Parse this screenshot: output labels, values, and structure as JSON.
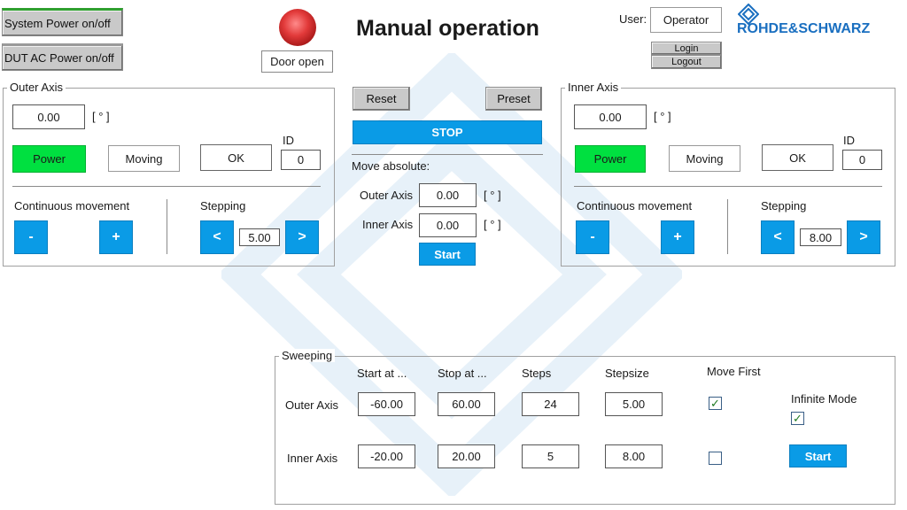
{
  "header": {
    "title": "Manual operation",
    "system_power_label": "System Power on/off",
    "dut_power_label": "DUT AC Power on/off",
    "door_status": "Door open",
    "user_label": "User:",
    "user_value": "Operator",
    "login_label": "Login",
    "logout_label": "Logout",
    "brand_name": "ROHDE&SCHWARZ"
  },
  "outer_axis": {
    "title": "Outer Axis",
    "position": "0.00",
    "unit": "[ ° ]",
    "power_label": "Power",
    "moving_label": "Moving",
    "ok_label": "OK",
    "id_label": "ID",
    "id_value": "0",
    "continuous_label": "Continuous movement",
    "stepping_label": "Stepping",
    "minus_label": "-",
    "plus_label": "+",
    "step_left_label": "<",
    "step_right_label": ">",
    "step_value": "5.00"
  },
  "inner_axis": {
    "title": "Inner Axis",
    "position": "0.00",
    "unit": "[ ° ]",
    "power_label": "Power",
    "moving_label": "Moving",
    "ok_label": "OK",
    "id_label": "ID",
    "id_value": "0",
    "continuous_label": "Continuous movement",
    "stepping_label": "Stepping",
    "minus_label": "-",
    "plus_label": "+",
    "step_left_label": "<",
    "step_right_label": ">",
    "step_value": "8.00"
  },
  "center": {
    "reset_label": "Reset",
    "preset_label": "Preset",
    "stop_label": "STOP",
    "move_absolute_label": "Move absolute:",
    "outer_label": "Outer Axis",
    "outer_value": "0.00",
    "inner_label": "Inner Axis",
    "inner_value": "0.00",
    "unit": "[ ° ]",
    "start_label": "Start"
  },
  "sweeping": {
    "title": "Sweeping",
    "columns": [
      "Start at ...",
      "Stop at ...",
      "Steps",
      "Stepsize",
      "Move First"
    ],
    "rows": [
      {
        "label": "Outer Axis",
        "start": "-60.00",
        "stop": "60.00",
        "steps": "24",
        "stepsize": "5.00",
        "move_first": true
      },
      {
        "label": "Inner Axis",
        "start": "-20.00",
        "stop": "20.00",
        "steps": "5",
        "stepsize": "8.00",
        "move_first": false
      }
    ],
    "infinite_mode_label": "Infinite Mode",
    "infinite_mode": true,
    "start_label": "Start",
    "check_mark": "✓"
  },
  "colors": {
    "accent_blue": "#0a9be6",
    "power_green": "#00e040",
    "door_led_red": "#e23a3a",
    "brand_blue": "#1a6fc0"
  }
}
